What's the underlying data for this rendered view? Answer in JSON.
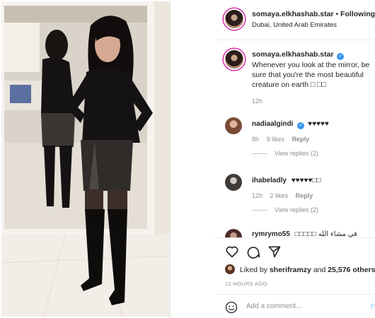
{
  "post": {
    "username": "somaya.elkhashab.star",
    "follow_separator": "•",
    "follow_label": "Following",
    "location": "Dubai, United Arab Emirates"
  },
  "caption": {
    "username": "somaya.elkhashab.star",
    "text": "Whenever you look at the mirror, be sure that you're the most beautiful creature on earth □ □□",
    "time": "12h"
  },
  "comments": [
    {
      "username": "nadiaalgindi",
      "verified": true,
      "text": "♥♥♥♥♥",
      "time": "8h",
      "likes": "9 likes",
      "reply": "Reply",
      "view_replies": "View replies (2)"
    },
    {
      "username": "ihabeladly",
      "verified": false,
      "text": "♥♥♥♥♥□□",
      "time": "12h",
      "likes": "2 likes",
      "reply": "Reply",
      "view_replies": "View replies (2)"
    },
    {
      "username": "rymrymo55",
      "verified": false,
      "text": "□□□□□ في مشاء الله"
    }
  ],
  "actions": {
    "icons": [
      "heart-icon",
      "comment-icon",
      "share-icon"
    ]
  },
  "likes": {
    "prefix": "Liked by",
    "user": "sheriframzy",
    "and": "and",
    "count": "25,576 others"
  },
  "timestamp": "12 HOURS AGO",
  "add_comment": {
    "placeholder": "Add a comment...",
    "post_label": "P"
  },
  "colors": {
    "verified": "#3897f0",
    "text": "#262626",
    "muted": "#8e8e8e",
    "story_ring": "#d6249f"
  }
}
